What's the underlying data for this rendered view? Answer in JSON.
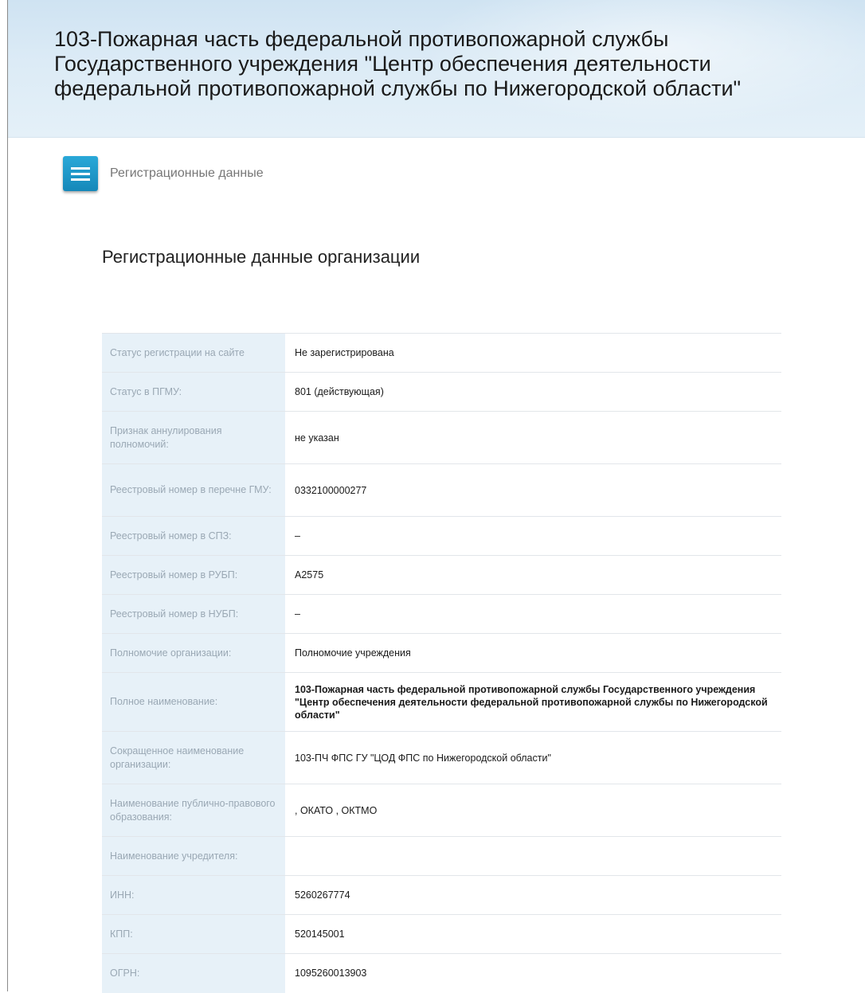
{
  "header": {
    "title": "103-Пожарная часть федеральной противопожарной службы Государственного учреждения \"Центр обеспечения деятельности федеральной противопожарной службы по Нижегородской области\""
  },
  "nav": {
    "menu_icon": "menu-icon",
    "breadcrumb": "Регистрационные данные"
  },
  "main": {
    "section_title": "Регистрационные данные организации",
    "rows": [
      {
        "label": "Статус регистрации на сайте",
        "value": "Не зарегистрирована"
      },
      {
        "label": "Статус в ПГМУ:",
        "value": "801 (действующая)"
      },
      {
        "label": "Признак аннулирования полномочий:",
        "value": "не указан"
      },
      {
        "label": "Реестровый номер в перечне ГМУ:",
        "value": "0332100000277"
      },
      {
        "label": "Реестровый номер в СПЗ:",
        "value": "–"
      },
      {
        "label": "Реестровый номер в РУБП:",
        "value": "А2575"
      },
      {
        "label": "Реестровый номер в НУБП:",
        "value": "–"
      },
      {
        "label": "Полномочие организации:",
        "value": "Полномочие учреждения"
      },
      {
        "label": "Полное наименование:",
        "value": "103-Пожарная часть федеральной противопожарной службы Государственного учреждения \"Центр обеспечения деятельности федеральной противопожарной службы по Нижегородской области\""
      },
      {
        "label": "Сокращенное наименование организации:",
        "value": "103-ПЧ ФПС ГУ \"ЦОД ФПС по Нижегородской области\""
      },
      {
        "label": "Наименование публично-правового образования:",
        "value": ", ОКАТО , ОКТМО"
      },
      {
        "label": "Наименование учредителя:",
        "value": ""
      },
      {
        "label": "ИНН:",
        "value": "5260267774"
      },
      {
        "label": "КПП:",
        "value": "520145001"
      },
      {
        "label": "ОГРН:",
        "value": "1095260013903"
      }
    ]
  }
}
